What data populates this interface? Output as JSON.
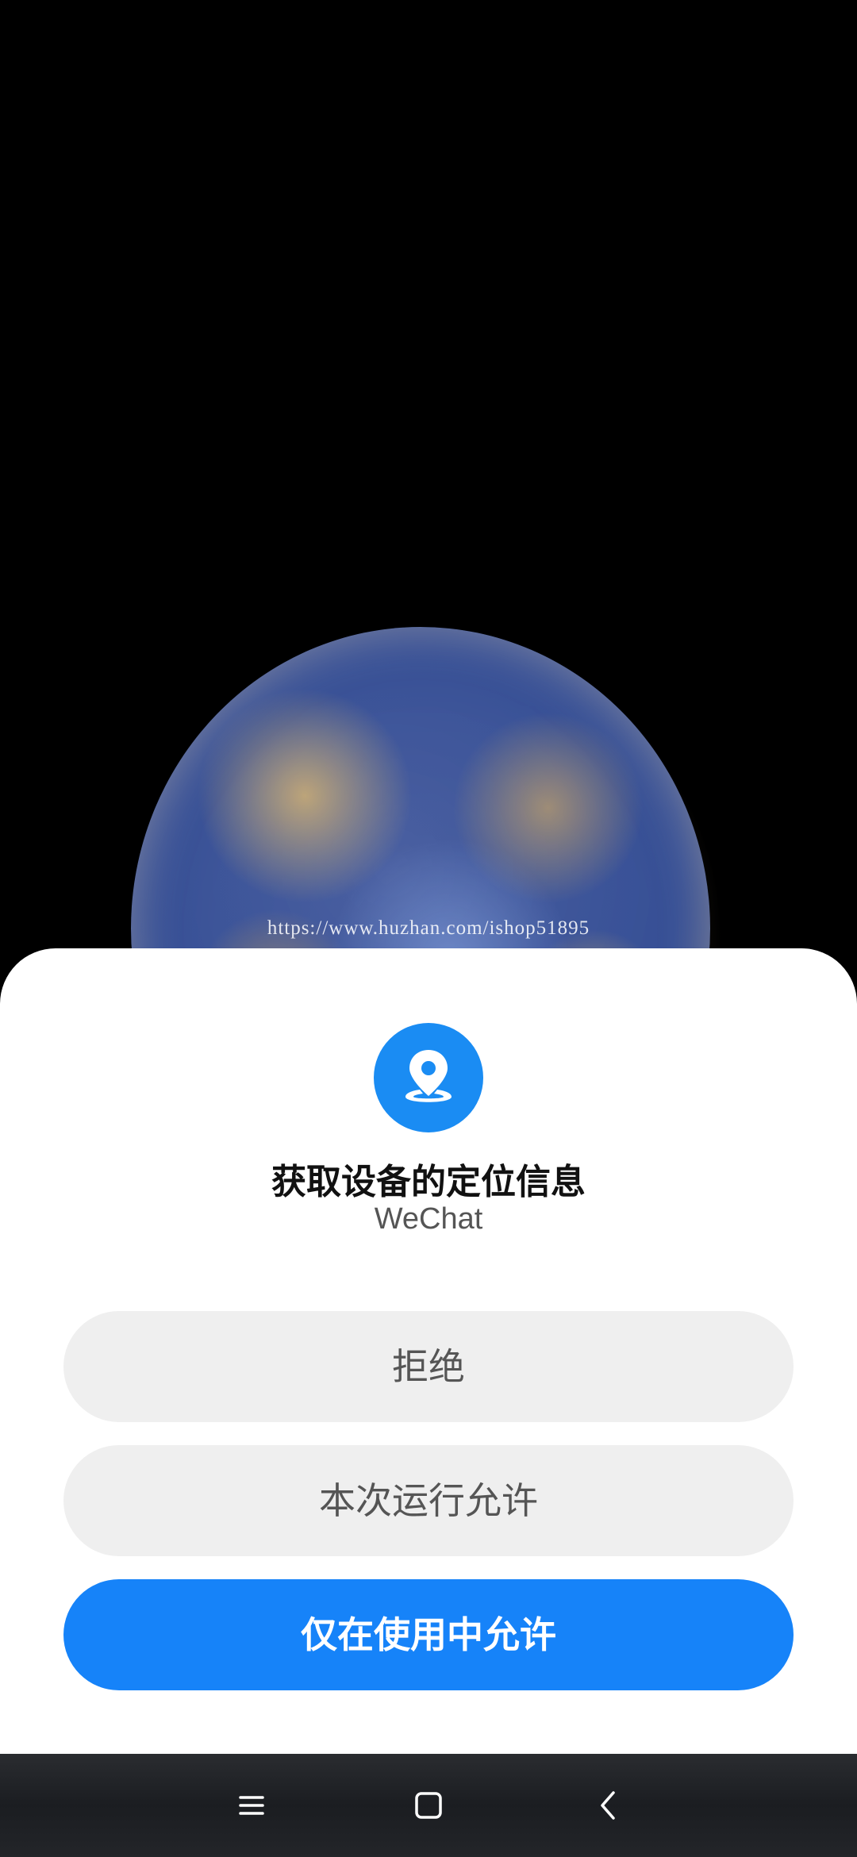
{
  "wallpaper": {
    "watermark_text": "https://www.huzhan.com/ishop51895"
  },
  "dialog": {
    "icon": "location-pin-icon",
    "title": "获取设备的定位信息",
    "app_name": "WeChat",
    "buttons": {
      "deny": "拒绝",
      "allow_once": "本次运行允许",
      "allow_while_using": "仅在使用中允许"
    },
    "colors": {
      "accent": "#1683f9",
      "icon_bg": "#1a8cf3",
      "secondary_button_bg": "#efefef"
    }
  },
  "navbar": {
    "menu_icon": "menu-lines-icon",
    "home_icon": "home-square-icon",
    "back_icon": "back-chevron-icon"
  }
}
